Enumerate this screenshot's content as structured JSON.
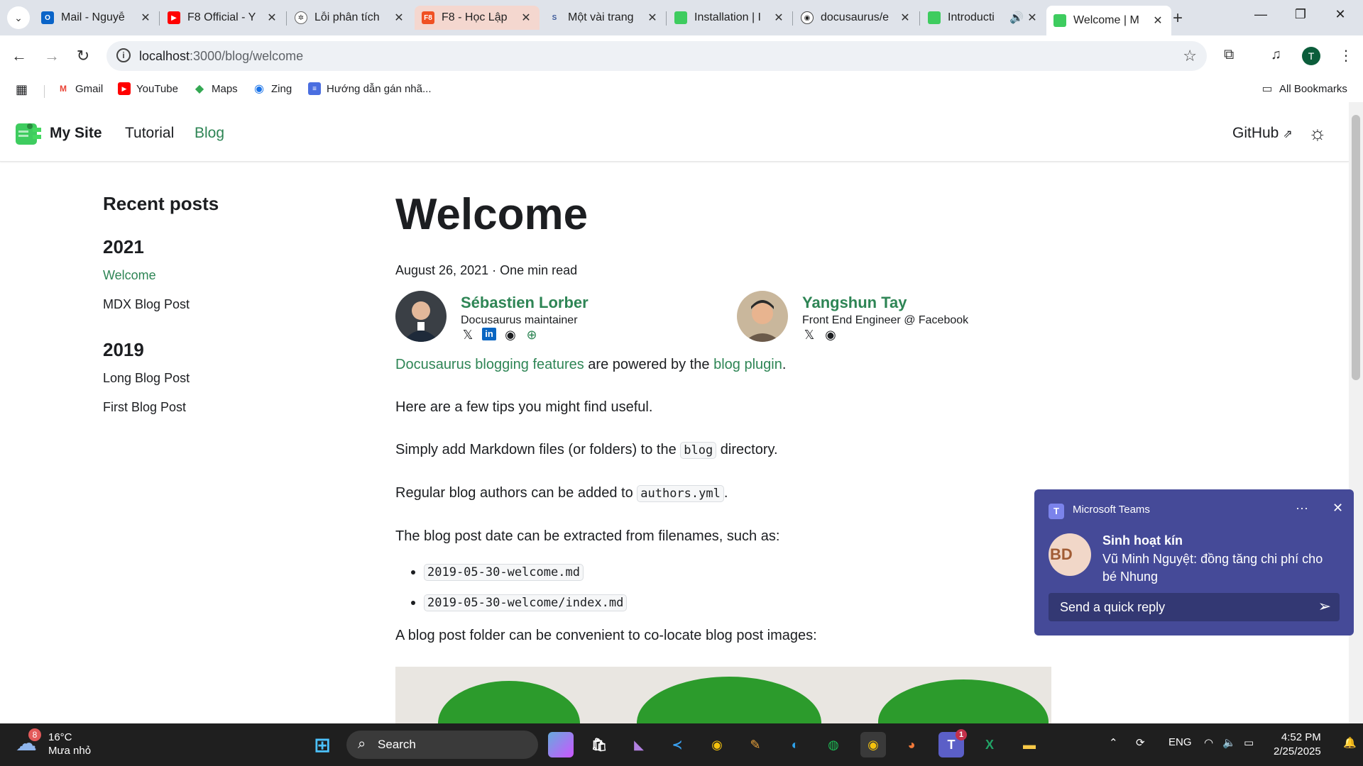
{
  "browser": {
    "tabs": [
      {
        "title": "Mail - Nguyễ",
        "favicon": "outlook-icon"
      },
      {
        "title": "F8 Official - Y",
        "favicon": "youtube-icon"
      },
      {
        "title": "Lỗi phân tích",
        "favicon": "chatgpt-icon"
      },
      {
        "title": "F8 - Học Lập",
        "favicon": "f8-icon"
      },
      {
        "title": "Một vài trang",
        "favicon": "s-icon"
      },
      {
        "title": "Installation | I",
        "favicon": "docusaurus-icon"
      },
      {
        "title": "docusaurus/e",
        "favicon": "github-icon"
      },
      {
        "title": "Introducti",
        "favicon": "docusaurus-icon"
      },
      {
        "title": "Welcome | M",
        "favicon": "docusaurus-icon"
      }
    ],
    "url_host": "localhost",
    "url_path": ":3000/blog/welcome",
    "profile_initial": "T",
    "bookmarks": [
      "Gmail",
      "YouTube",
      "Maps",
      "Zing",
      "Hướng dẫn gán nhã..."
    ],
    "all_bookmarks": "All Bookmarks"
  },
  "site": {
    "title": "My Site",
    "nav": [
      "Tutorial",
      "Blog"
    ],
    "github": "GitHub"
  },
  "sidebar": {
    "title": "Recent posts",
    "groups": [
      {
        "year": "2021",
        "items": [
          "Welcome",
          "MDX Blog Post"
        ]
      },
      {
        "year": "2019",
        "items": [
          "Long Blog Post",
          "First Blog Post"
        ]
      }
    ]
  },
  "post": {
    "title": "Welcome",
    "meta": "August 26, 2021 · One min read",
    "authors": [
      {
        "name": "Sébastien Lorber",
        "role": "Docusaurus maintainer"
      },
      {
        "name": "Yangshun Tay",
        "role": "Front End Engineer @ Facebook"
      }
    ],
    "p1_link1": "Docusaurus blogging features",
    "p1_mid": " are powered by the ",
    "p1_link2": "blog plugin",
    "p1_end": ".",
    "p2": "Here are a few tips you might find useful.",
    "p3_a": "Simply add Markdown files (or folders) to the ",
    "p3_code": "blog",
    "p3_b": " directory.",
    "p4_a": "Regular blog authors can be added to ",
    "p4_code": "authors.yml",
    "p4_b": ".",
    "p5": "The blog post date can be extracted from filenames, such as:",
    "files": [
      "2019-05-30-welcome.md",
      "2019-05-30-welcome/index.md"
    ],
    "p6": "A blog post folder can be convenient to co-locate blog post images:"
  },
  "toast": {
    "app": "Microsoft Teams",
    "chat": "Sinh hoạt kín",
    "message": "Vũ Minh Nguyệt: đồng tăng chi phí cho bé Nhung",
    "reply_placeholder": "Send a quick reply",
    "avatar_text": "BD"
  },
  "taskbar": {
    "temperature": "16°C",
    "weather": "Mưa nhỏ",
    "weather_badge": "8",
    "search": "Search",
    "lang": "ENG",
    "time": "4:52 PM",
    "date": "2/25/2025",
    "teams_badge": "1"
  },
  "colors": {
    "accent": "#2e8555",
    "toast": "#454a98",
    "taskbar": "#1f1f1f"
  }
}
